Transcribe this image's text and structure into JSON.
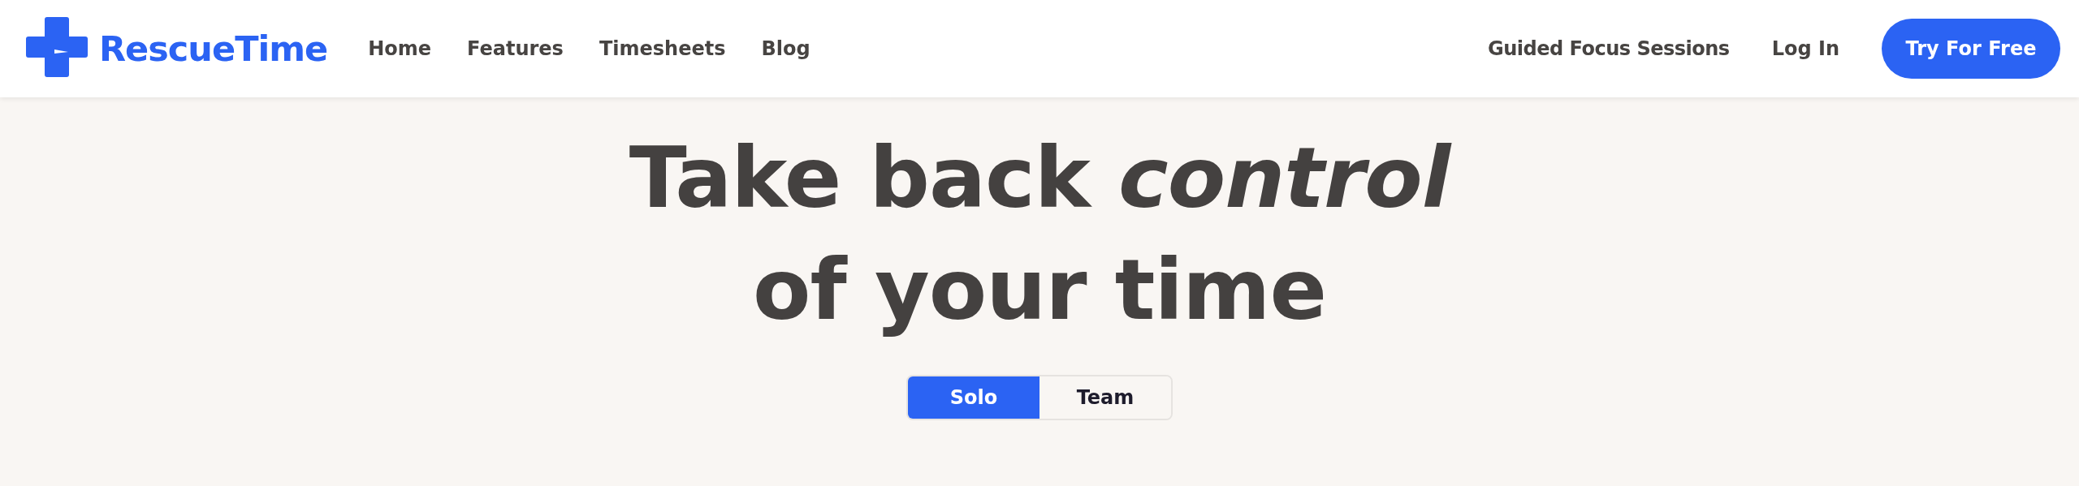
{
  "header": {
    "brand": "RescueTime",
    "nav": [
      "Home",
      "Features",
      "Timesheets",
      "Blog"
    ],
    "right_links": [
      "Guided Focus Sessions",
      "Log In"
    ],
    "cta": "Try For Free"
  },
  "hero": {
    "headline_lines": [
      "Take back *control*",
      "of your time"
    ],
    "plan_toggle": [
      {
        "label": "Solo",
        "selected": true
      },
      {
        "label": "Team",
        "selected": false
      }
    ]
  }
}
